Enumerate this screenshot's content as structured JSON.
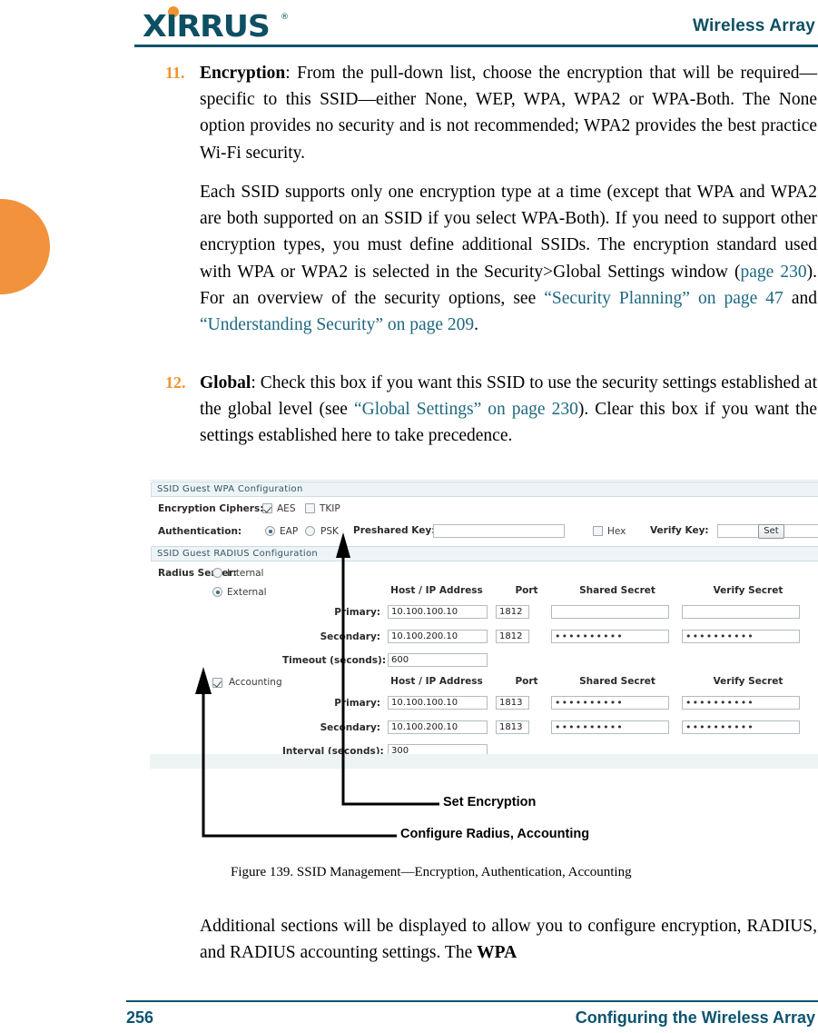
{
  "header": {
    "logo_text": "XIRRUS",
    "logo_trademark": "®",
    "title": "Wireless Array"
  },
  "footer": {
    "page_number": "256",
    "section_title": "Configuring the Wireless Array"
  },
  "body": {
    "item11": {
      "number": "11.",
      "lead": "Encryption",
      "text": ": From the pull-down list, choose the encryption that will be required—specific to this SSID—either None, WEP, WPA, WPA2 or WPA-Both. The None option provides no security and is not recommended; WPA2 provides the best practice Wi-Fi security."
    },
    "para_each_ssid": {
      "t1": "Each SSID supports only one encryption type at a time (except that WPA and WPA2 are both supported on an SSID if you select WPA-Both). If you need to support other encryption types, you must define additional SSIDs. The encryption standard used with WPA or WPA2 is selected in the Security>Global Settings window (",
      "link1": "page 230",
      "t2": "). For an overview of the security options, see ",
      "link2": "“Security Planning” on page 47",
      "t3": " and ",
      "link3": "“Understanding Security” on page 209",
      "t4": "."
    },
    "item12": {
      "number": "12.",
      "lead": "Global",
      "t1": ": Check this box if you want this SSID to use the security settings established at the global level (see ",
      "link1": "“Global Settings” on page 230",
      "t2": "). Clear this box if you want the settings established here to take precedence."
    },
    "caption": "Figure 139. SSID Management—Encryption, Authentication, Accounting",
    "para_additional": "Additional sections will be displayed to allow you to configure encryption, RADIUS, and RADIUS accounting settings. The ",
    "para_additional_bold": "WPA"
  },
  "callouts": [
    {
      "label": "Set Encryption"
    },
    {
      "label": "Configure Radius, Accounting"
    }
  ],
  "screenshot": {
    "wpa_section": {
      "title": "SSID Guest  WPA Configuration",
      "ciphers_label": "Encryption Ciphers:",
      "aes_label": "AES",
      "aes_checked": true,
      "tkip_label": "TKIP",
      "tkip_checked": false,
      "auth_label": "Authentication:",
      "eap_label": "EAP",
      "eap_selected": true,
      "psk_label": "PSK",
      "psk_selected": false,
      "preshared_key_label": "Preshared Key:",
      "preshared_key_value": "",
      "hex_label": "Hex",
      "hex_checked": false,
      "verify_key_label": "Verify Key:",
      "verify_key_value": "",
      "set_button": "Set"
    },
    "radius_section": {
      "title": "SSID Guest  RADIUS Configuration",
      "server_label": "Radius Server:",
      "internal_label": "Internal",
      "internal_selected": false,
      "external_label": "External",
      "external_selected": true,
      "columns": [
        "Host / IP Address",
        "Port",
        "Shared Secret",
        "Verify Secret"
      ],
      "rows": [
        {
          "label": "Primary:",
          "host": "10.100.100.10",
          "port": "1812",
          "shared_secret": "",
          "verify_secret": ""
        },
        {
          "label": "Secondary:",
          "host": "10.100.200.10",
          "port": "1812",
          "shared_secret": "••••••••••",
          "verify_secret": "••••••••••"
        }
      ],
      "timeout_label": "Timeout (seconds):",
      "timeout_value": "600",
      "accounting_label": "Accounting",
      "accounting_checked": true,
      "acct_columns": [
        "Host / IP Address",
        "Port",
        "Shared Secret",
        "Verify Secret"
      ],
      "acct_rows": [
        {
          "label": "Primary:",
          "host": "10.100.100.10",
          "port": "1813",
          "shared_secret": "••••••••••",
          "verify_secret": "••••••••••"
        },
        {
          "label": "Secondary:",
          "host": "10.100.200.10",
          "port": "1813",
          "shared_secret": "••••••••••",
          "verify_secret": "••••••••••"
        }
      ],
      "interval_label": "Interval (seconds):",
      "interval_value": "300"
    }
  },
  "colors": {
    "brand_teal": "#0b5470",
    "brand_orange": "#f3932f",
    "link_teal": "#1d6880",
    "panel_header_bg": "#edf4f7"
  }
}
